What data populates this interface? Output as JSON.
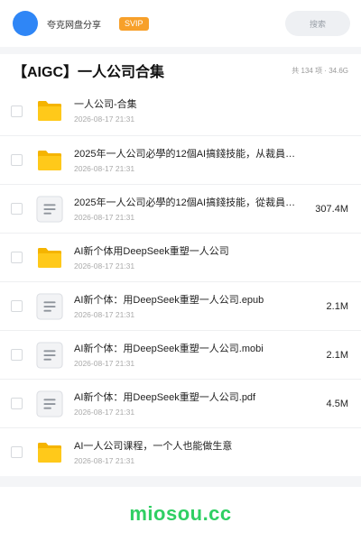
{
  "header": {
    "app_name": "夸克网盘分享",
    "badge": "SVIP",
    "search_placeholder": "搜索",
    "colors": {
      "avatar": "#2f86f6",
      "badge": "#f7a02a"
    }
  },
  "folder": {
    "title": "【AIGC】一人公司合集",
    "meta": "共 134 项 · 34.6G"
  },
  "files": [
    {
      "name": "一人公司-合集",
      "date": "2026-08-17 21:31",
      "size": "",
      "icon": "folder-icon"
    },
    {
      "name": "2025年一人公司必學的12個AI搞錢技能，从裁員…",
      "date": "2026-08-17 21:31",
      "size": "",
      "icon": "folder-icon"
    },
    {
      "name": "2025年一人公司必學的12個AI搞錢技能，從裁員…",
      "date": "2026-08-17 21:31",
      "size": "307.4M",
      "icon": "document-icon"
    },
    {
      "name": "AI新个体用DeepSeek重塑一人公司",
      "date": "2026-08-17 21:31",
      "size": "",
      "icon": "folder-icon"
    },
    {
      "name": "AI新个体：用DeepSeek重塑一人公司.epub",
      "date": "2026-08-17 21:31",
      "size": "2.1M",
      "icon": "document-icon"
    },
    {
      "name": "AI新个体：用DeepSeek重塑一人公司.mobi",
      "date": "2026-08-17 21:31",
      "size": "2.1M",
      "icon": "document-icon"
    },
    {
      "name": "AI新个体：用DeepSeek重塑一人公司.pdf",
      "date": "2026-08-17 21:31",
      "size": "4.5M",
      "icon": "document-icon"
    },
    {
      "name": "AI一人公司课程，一个人也能做生意",
      "date": "2026-08-17 21:31",
      "size": "",
      "icon": "folder-icon"
    }
  ],
  "footer": {
    "watermark": "miosou.cc",
    "color": "#2fcf63"
  }
}
